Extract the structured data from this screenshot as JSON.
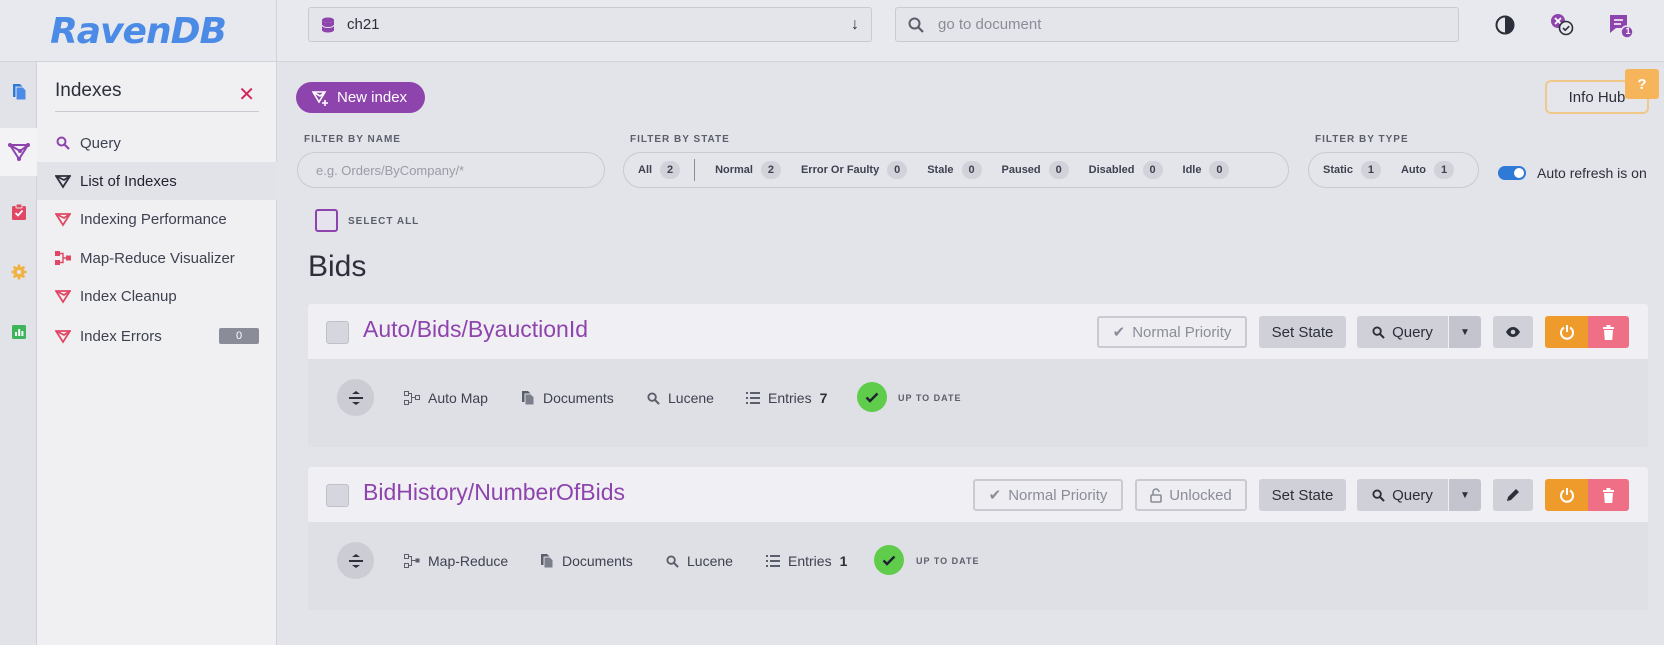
{
  "app": {
    "logo": "RavenDB"
  },
  "topbar": {
    "database": "ch21",
    "goto_placeholder": "go to document",
    "notifications_count": "1"
  },
  "sidemenu": {
    "title": "Indexes",
    "items": [
      {
        "label": "Query",
        "icon": "search-icon"
      },
      {
        "label": "List of Indexes",
        "icon": "index-icon",
        "active": true
      },
      {
        "label": "Indexing Performance",
        "icon": "index-performance-icon"
      },
      {
        "label": "Map-Reduce Visualizer",
        "icon": "map-reduce-icon"
      },
      {
        "label": "Index Cleanup",
        "icon": "index-cleanup-icon"
      },
      {
        "label": "Index Errors",
        "icon": "index-errors-icon",
        "badge": "0"
      }
    ]
  },
  "toolbar": {
    "new_index_label": "New index",
    "info_hub_label": "Info Hub",
    "info_hub_badge": "?"
  },
  "filters": {
    "by_name_label": "FILTER BY NAME",
    "by_name_placeholder": "e.g. Orders/ByCompany/*",
    "by_state_label": "FILTER BY STATE",
    "states": [
      {
        "label": "All",
        "count": "2"
      },
      {
        "label": "Normal",
        "count": "2"
      },
      {
        "label": "Error Or Faulty",
        "count": "0"
      },
      {
        "label": "Stale",
        "count": "0"
      },
      {
        "label": "Paused",
        "count": "0"
      },
      {
        "label": "Disabled",
        "count": "0"
      },
      {
        "label": "Idle",
        "count": "0"
      }
    ],
    "by_type_label": "FILTER BY TYPE",
    "types": [
      {
        "label": "Static",
        "count": "1"
      },
      {
        "label": "Auto",
        "count": "1"
      }
    ],
    "auto_refresh_label": "Auto refresh is on",
    "select_all_label": "SELECT ALL"
  },
  "group": {
    "title": "Bids"
  },
  "indexes": [
    {
      "name": "Auto/Bids/ByauctionId",
      "priority": "Normal Priority",
      "set_state": "Set State",
      "query": "Query",
      "type": "Auto Map",
      "source": "Documents",
      "engine": "Lucene",
      "entries_label": "Entries",
      "entries_count": "7",
      "status": "UP TO DATE"
    },
    {
      "name": "BidHistory/NumberOfBids",
      "priority": "Normal Priority",
      "lock": "Unlocked",
      "set_state": "Set State",
      "query": "Query",
      "type": "Map-Reduce",
      "source": "Documents",
      "engine": "Lucene",
      "entries_label": "Entries",
      "entries_count": "1",
      "status": "UP TO DATE"
    }
  ],
  "colors": {
    "accent": "#8e44ad",
    "brand": "#4b8be6",
    "success": "#5fcd4b",
    "warning": "#ef9b2b",
    "danger": "#ef6f86"
  }
}
